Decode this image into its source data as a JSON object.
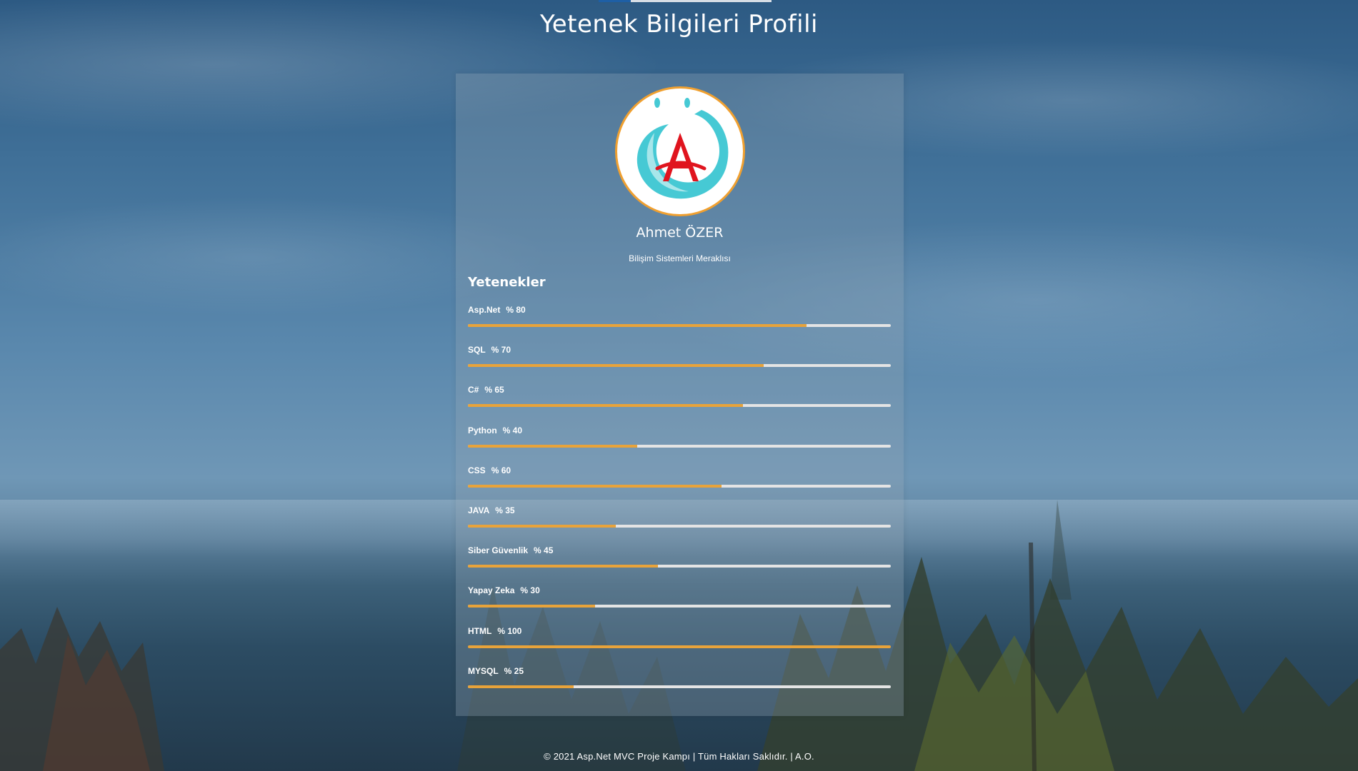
{
  "page": {
    "title": "Yetenek Bilgileri Profili"
  },
  "profile": {
    "name": "Ahmet ÖZER",
    "subtitle": "Bilişim Sistemleri Meraklısı",
    "logo_letter": "A"
  },
  "skills": {
    "heading": "Yetenekler",
    "items": [
      {
        "name": "Asp.Net",
        "percent_label": "% 80",
        "value": 80
      },
      {
        "name": "SQL",
        "percent_label": "% 70",
        "value": 70
      },
      {
        "name": "C#",
        "percent_label": "% 65",
        "value": 65
      },
      {
        "name": "Python",
        "percent_label": "% 40",
        "value": 40
      },
      {
        "name": "CSS",
        "percent_label": "% 60",
        "value": 60
      },
      {
        "name": "JAVA",
        "percent_label": "% 35",
        "value": 35
      },
      {
        "name": "Siber Güvenlik",
        "percent_label": "% 45",
        "value": 45
      },
      {
        "name": "Yapay Zeka",
        "percent_label": "% 30",
        "value": 30
      },
      {
        "name": "HTML",
        "percent_label": "% 100",
        "value": 100
      },
      {
        "name": "MYSQL",
        "percent_label": "% 25",
        "value": 25
      }
    ]
  },
  "footer": {
    "text": "© 2021 Asp.Net MVC Proje Kampı | Tüm Hakları Saklıdır. | A.O."
  },
  "colors": {
    "progress_fill": "#e8a33a",
    "progress_track": "#e4e4e4",
    "avatar_border": "#f0a030",
    "logo_red": "#e0141e",
    "logo_teal": "#3cc6d2"
  }
}
